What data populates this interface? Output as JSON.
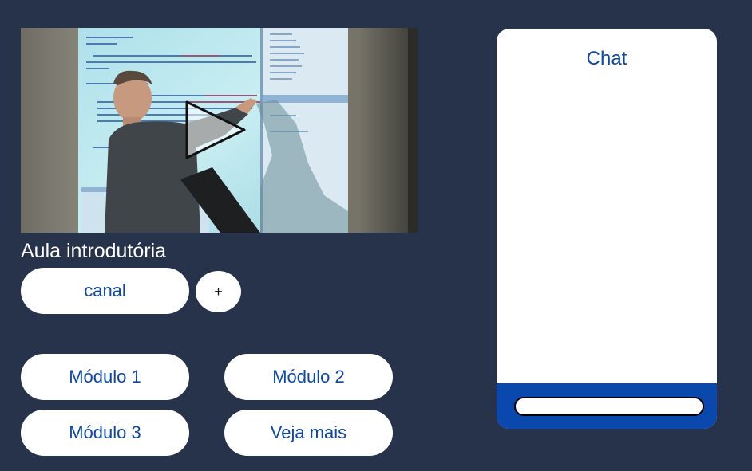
{
  "video": {
    "title": "Aula introdutória",
    "play_icon": "play-icon",
    "projected_code": [
      "</Document>",
      "typeAllManagedModulesForAllRequests=\"true\">",
      "ame=\"urlRewriter\" type=\"Intelligencia.UrlRewriter.Rewr",
      "<rewrite url=\"products\" to=\"/products.aspx?category",
      "url=\"/products\" to=\"/products.aspx?categor",
      "url=\"/products/books\" to=\"/products.aspx?category",
      "url=\"/products/DVDs\" to=\"/products.aspx?category"
    ]
  },
  "channel": {
    "label": "canal",
    "add_label": "+"
  },
  "modules": [
    {
      "label": "Módulo 1"
    },
    {
      "label": "Módulo 2"
    },
    {
      "label": "Módulo 3"
    },
    {
      "label": "Veja mais"
    }
  ],
  "chat": {
    "title": "Chat",
    "input_value": "",
    "input_placeholder": ""
  },
  "colors": {
    "background": "#26334a",
    "accent": "#0d47a8",
    "chat_footer": "#0a48ad",
    "surface": "#ffffff"
  }
}
